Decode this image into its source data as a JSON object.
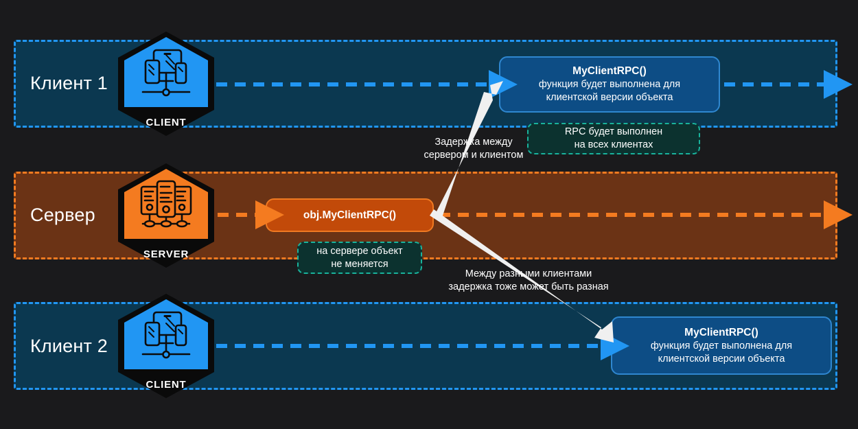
{
  "theme": {
    "background": "#1a1a1c",
    "client_accent": "#2196f3",
    "client_lane_fill": "#0b3850",
    "client_box_fill": "#0d4d85",
    "server_accent": "#f47b20",
    "server_lane_fill": "#6b3315",
    "server_box_fill": "#c24a09",
    "note_border": "#19b39c",
    "note_fill": "#0c322f",
    "arrow_white": "#f0f0f0",
    "text": "#ffffff"
  },
  "lanes": [
    {
      "id": "client1",
      "label": "Клиент 1",
      "badge": {
        "icon": "client-devices-icon",
        "caption": "CLIENT"
      }
    },
    {
      "id": "server",
      "label": "Сервер",
      "badge": {
        "icon": "server-racks-icon",
        "caption": "SERVER"
      }
    },
    {
      "id": "client2",
      "label": "Клиент 2",
      "badge": {
        "icon": "client-devices-icon",
        "caption": "CLIENT"
      }
    }
  ],
  "boxes": {
    "client1_rpc": {
      "title": "MyClientRPC()",
      "line1": "функция будет выполнена для",
      "line2": "клиентской версии объекта"
    },
    "server_rpc": {
      "title": "obj.MyClientRPC()"
    },
    "client2_rpc": {
      "title": "MyClientRPC()",
      "line1": "функция будет выполнена для",
      "line2": "клиентской версии объекта"
    }
  },
  "notes": {
    "all_clients": {
      "line1": "RPC будет выполнен",
      "line2": "на всех клиентах"
    },
    "server_unchanged": {
      "line1": "на сервере объект",
      "line2": "не меняется"
    }
  },
  "captions": {
    "latency_server_client": {
      "line1": "Задержка между",
      "line2": "сервером и клиентом"
    },
    "latency_between_clients": {
      "line1": "Между разными клиентами",
      "line2": "задержка тоже может быть разная"
    }
  }
}
